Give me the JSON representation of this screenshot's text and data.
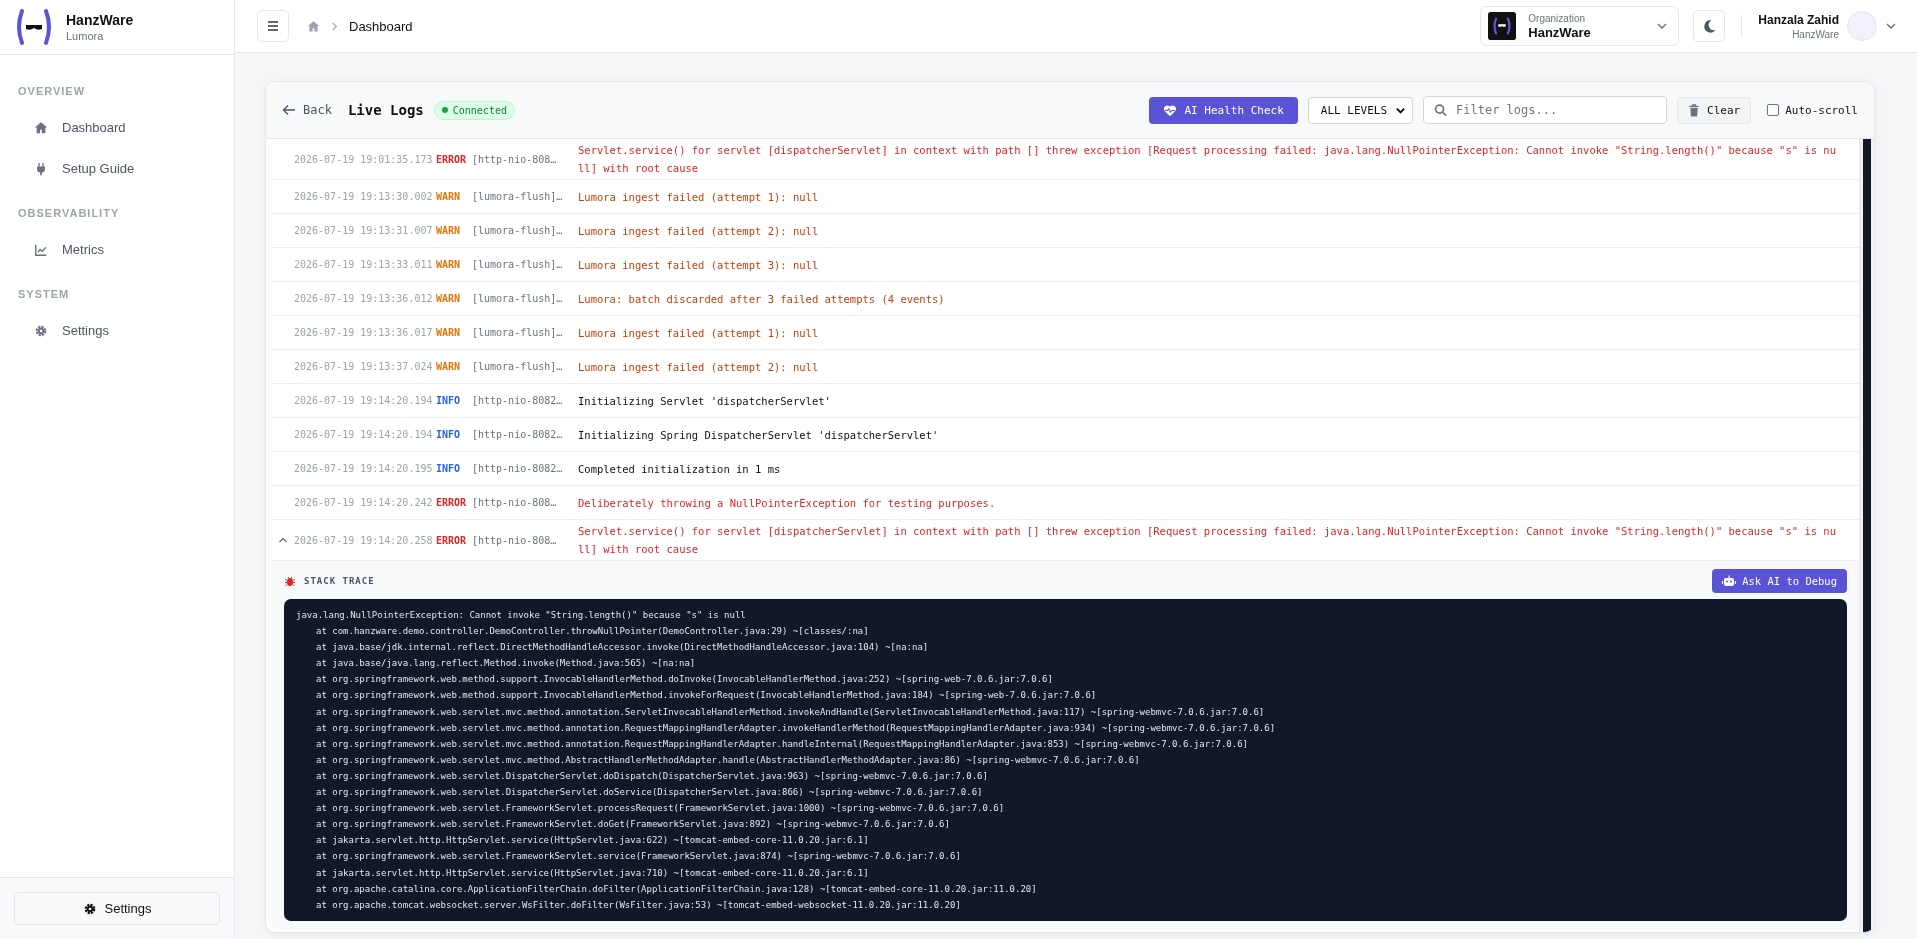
{
  "sidebar": {
    "brand": {
      "name": "HanzWare",
      "subtitle": "Lumora"
    },
    "sections": [
      {
        "title": "OVERVIEW",
        "items": [
          {
            "label": "Dashboard"
          },
          {
            "label": "Setup Guide"
          }
        ]
      },
      {
        "title": "OBSERVABILITY",
        "items": [
          {
            "label": "Metrics"
          }
        ]
      },
      {
        "title": "SYSTEM",
        "items": [
          {
            "label": "Settings"
          }
        ]
      }
    ],
    "footer_button": "Settings"
  },
  "topbar": {
    "breadcrumb": "Dashboard",
    "organization": {
      "caption": "Organization",
      "name": "HanzWare"
    },
    "user": {
      "name": "Hanzala Zahid",
      "org": "HanzWare"
    }
  },
  "logs": {
    "back": "Back",
    "title": "Live Logs",
    "status": "Connected",
    "health_button": "AI Health Check",
    "level_filter": "ALL LEVELS",
    "search": {
      "placeholder": "Filter logs..."
    },
    "clear_button": "Clear",
    "auto_scroll": {
      "label": "Auto-scroll",
      "checked": false
    },
    "rows": [
      {
        "time": "2026-07-19 19:01:35.173",
        "kind": "error",
        "level": "ERROR",
        "thread": "[http-nio-808…",
        "message": "Servlet.service() for servlet [dispatcherServlet] in context with path [] threw exception [Request processing failed: java.lang.NullPointerException: Cannot invoke \"String.length()\" because \"s\" is null] with root cause",
        "expanded": false
      },
      {
        "time": "2026-07-19 19:13:30.002",
        "kind": "warn",
        "level": "WARN",
        "thread": "[lumora-flush]…",
        "message": "Lumora ingest failed (attempt 1): null",
        "expanded": false
      },
      {
        "time": "2026-07-19 19:13:31.007",
        "kind": "warn",
        "level": "WARN",
        "thread": "[lumora-flush]…",
        "message": "Lumora ingest failed (attempt 2): null",
        "expanded": false
      },
      {
        "time": "2026-07-19 19:13:33.011",
        "kind": "warn",
        "level": "WARN",
        "thread": "[lumora-flush]…",
        "message": "Lumora ingest failed (attempt 3): null",
        "expanded": false
      },
      {
        "time": "2026-07-19 19:13:36.012",
        "kind": "warn",
        "level": "WARN",
        "thread": "[lumora-flush]…",
        "message": "Lumora: batch discarded after 3 failed attempts (4 events)",
        "expanded": false
      },
      {
        "time": "2026-07-19 19:13:36.017",
        "kind": "warn",
        "level": "WARN",
        "thread": "[lumora-flush]…",
        "message": "Lumora ingest failed (attempt 1): null",
        "expanded": false
      },
      {
        "time": "2026-07-19 19:13:37.024",
        "kind": "warn",
        "level": "WARN",
        "thread": "[lumora-flush]…",
        "message": "Lumora ingest failed (attempt 2): null",
        "expanded": false
      },
      {
        "time": "2026-07-19 19:14:20.194",
        "kind": "info",
        "level": "INFO",
        "thread": "[http-nio-8082…",
        "message": "Initializing Servlet 'dispatcherServlet'",
        "expanded": false
      },
      {
        "time": "2026-07-19 19:14:20.194",
        "kind": "info",
        "level": "INFO",
        "thread": "[http-nio-8082…",
        "message": "Initializing Spring DispatcherServlet 'dispatcherServlet'",
        "expanded": false
      },
      {
        "time": "2026-07-19 19:14:20.195",
        "kind": "info",
        "level": "INFO",
        "thread": "[http-nio-8082…",
        "message": "Completed initialization in 1 ms",
        "expanded": false
      },
      {
        "time": "2026-07-19 19:14:20.242",
        "kind": "error",
        "level": "ERROR",
        "thread": "[http-nio-808…",
        "message": "Deliberately throwing a NullPointerException for testing purposes.",
        "expanded": false
      },
      {
        "time": "2026-07-19 19:14:20.258",
        "kind": "error",
        "level": "ERROR",
        "thread": "[http-nio-808…",
        "message": "Servlet.service() for servlet [dispatcherServlet] in context with path [] threw exception [Request processing failed: java.lang.NullPointerException: Cannot invoke \"String.length()\" because \"s\" is null] with root cause",
        "expanded": true,
        "stack_trace": {
          "title": "STACK TRACE",
          "button": "Ask AI to Debug",
          "exception": "java.lang.NullPointerException: Cannot invoke \"String.length()\" because \"s\" is null",
          "frames": [
            "at com.hanzware.demo.controller.DemoController.throwNullPointer(DemoController.java:29) ~[classes/:na]",
            "at java.base/jdk.internal.reflect.DirectMethodHandleAccessor.invoke(DirectMethodHandleAccessor.java:104) ~[na:na]",
            "at java.base/java.lang.reflect.Method.invoke(Method.java:565) ~[na:na]",
            "at org.springframework.web.method.support.InvocableHandlerMethod.doInvoke(InvocableHandlerMethod.java:252) ~[spring-web-7.0.6.jar:7.0.6]",
            "at org.springframework.web.method.support.InvocableHandlerMethod.invokeForRequest(InvocableHandlerMethod.java:184) ~[spring-web-7.0.6.jar:7.0.6]",
            "at org.springframework.web.servlet.mvc.method.annotation.ServletInvocableHandlerMethod.invokeAndHandle(ServletInvocableHandlerMethod.java:117) ~[spring-webmvc-7.0.6.jar:7.0.6]",
            "at org.springframework.web.servlet.mvc.method.annotation.RequestMappingHandlerAdapter.invokeHandlerMethod(RequestMappingHandlerAdapter.java:934) ~[spring-webmvc-7.0.6.jar:7.0.6]",
            "at org.springframework.web.servlet.mvc.method.annotation.RequestMappingHandlerAdapter.handleInternal(RequestMappingHandlerAdapter.java:853) ~[spring-webmvc-7.0.6.jar:7.0.6]",
            "at org.springframework.web.servlet.mvc.method.AbstractHandlerMethodAdapter.handle(AbstractHandlerMethodAdapter.java:86) ~[spring-webmvc-7.0.6.jar:7.0.6]",
            "at org.springframework.web.servlet.DispatcherServlet.doDispatch(DispatcherServlet.java:963) ~[spring-webmvc-7.0.6.jar:7.0.6]",
            "at org.springframework.web.servlet.DispatcherServlet.doService(DispatcherServlet.java:866) ~[spring-webmvc-7.0.6.jar:7.0.6]",
            "at org.springframework.web.servlet.FrameworkServlet.processRequest(FrameworkServlet.java:1000) ~[spring-webmvc-7.0.6.jar:7.0.6]",
            "at org.springframework.web.servlet.FrameworkServlet.doGet(FrameworkServlet.java:892) ~[spring-webmvc-7.0.6.jar:7.0.6]",
            "at jakarta.servlet.http.HttpServlet.service(HttpServlet.java:622) ~[tomcat-embed-core-11.0.20.jar:6.1]",
            "at org.springframework.web.servlet.FrameworkServlet.service(FrameworkServlet.java:874) ~[spring-webmvc-7.0.6.jar:7.0.6]",
            "at jakarta.servlet.http.HttpServlet.service(HttpServlet.java:710) ~[tomcat-embed-core-11.0.20.jar:6.1]",
            "at org.apache.catalina.core.ApplicationFilterChain.doFilter(ApplicationFilterChain.java:128) ~[tomcat-embed-core-11.0.20.jar:11.0.20]",
            "at org.apache.tomcat.websocket.server.WsFilter.doFilter(WsFilter.java:53) ~[tomcat-embed-websocket-11.0.20.jar:11.0.20]"
          ]
        }
      }
    ]
  }
}
